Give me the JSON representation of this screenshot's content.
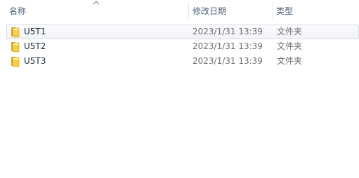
{
  "columns": {
    "name": "名称",
    "date_modified": "修改日期",
    "type": "类型"
  },
  "sort": {
    "column": "name",
    "direction": "ascending"
  },
  "files": [
    {
      "name": "U5T1",
      "date": "2023/1/31 13:39",
      "type": "文件夹",
      "icon": "folder-icon",
      "hovered": true
    },
    {
      "name": "U5T2",
      "date": "2023/1/31 13:39",
      "type": "文件夹",
      "icon": "folder-icon",
      "hovered": false
    },
    {
      "name": "U5T3",
      "date": "2023/1/31 13:39",
      "type": "文件夹",
      "icon": "folder-icon",
      "hovered": false
    }
  ]
}
